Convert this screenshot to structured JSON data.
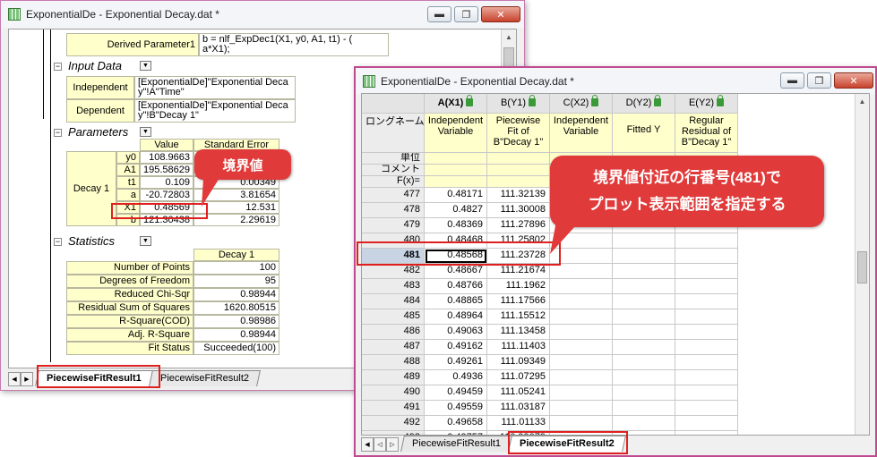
{
  "window1": {
    "title": "ExponentialDe - Exponential Decay.dat *",
    "derived_parameter_label": "Derived Parameter1",
    "derived_parameter_value_line1": "b = nlf_ExpDec1(X1, y0, A1, t1) - (",
    "derived_parameter_value_line2": "a*X1);",
    "input_data": {
      "section": "Input Data",
      "independent_label": "Independent",
      "independent_line1": "[ExponentialDe]\"Exponential Deca",
      "independent_line2": "y\"!A\"Time\"",
      "dependent_label": "Dependent",
      "dependent_line1": "[ExponentialDe]\"Exponential Deca",
      "dependent_line2": "y\"!B\"Decay 1\""
    },
    "parameters": {
      "section": "Parameters",
      "col_value": "Value",
      "col_stderr": "Standard Error",
      "group_label": "Decay 1",
      "rows": [
        {
          "name": "y0",
          "value": "108.9663",
          "stderr": ""
        },
        {
          "name": "A1",
          "value": "195.58629",
          "stderr": ""
        },
        {
          "name": "t1",
          "value": "0.109",
          "stderr": "0.00349"
        },
        {
          "name": "a",
          "value": "-20.72803",
          "stderr": "3.81654"
        },
        {
          "name": "X1",
          "value": "0.48569",
          "stderr": "12.531"
        },
        {
          "name": "b",
          "value": "121.30438",
          "stderr": "2.29619"
        }
      ]
    },
    "statistics": {
      "section": "Statistics",
      "col_header": "Decay 1",
      "rows": [
        {
          "label": "Number of Points",
          "value": "100"
        },
        {
          "label": "Degrees of Freedom",
          "value": "95"
        },
        {
          "label": "Reduced Chi-Sqr",
          "value": "0.98944"
        },
        {
          "label": "Residual Sum of Squares",
          "value": "1620.80515"
        },
        {
          "label": "R-Square(COD)",
          "value": "0.98986"
        },
        {
          "label": "Adj. R-Square",
          "value": "0.98944"
        },
        {
          "label": "Fit Status",
          "value": "Succeeded(100)"
        }
      ]
    },
    "tabs": [
      "PiecewiseFitResult1",
      "PiecewiseFitResult2"
    ],
    "active_tab": "PiecewiseFitResult1",
    "callout": "境界値"
  },
  "window2": {
    "title": "ExponentialDe - Exponential Decay.dat *",
    "columns": [
      {
        "name": "A(X1)",
        "longname": [
          "Independent",
          "Variable"
        ]
      },
      {
        "name": "B(Y1)",
        "longname": [
          "Piecewise",
          "Fit of",
          "B\"Decay 1\""
        ]
      },
      {
        "name": "C(X2)",
        "longname": [
          "Independent",
          "Variable"
        ]
      },
      {
        "name": "D(Y2)",
        "longname": [
          "Fitted Y"
        ]
      },
      {
        "name": "E(Y2)",
        "longname": [
          "Regular",
          "Residual of",
          "B\"Decay 1\""
        ]
      }
    ],
    "meta_rows": [
      "ロングネーム",
      "単位",
      "コメント",
      "F(x)="
    ],
    "rows": [
      {
        "n": "477",
        "a": "0.48171",
        "b": "111.32139"
      },
      {
        "n": "478",
        "a": "0.4827",
        "b": "111.30008"
      },
      {
        "n": "479",
        "a": "0.48369",
        "b": "111.27896"
      },
      {
        "n": "480",
        "a": "0.48468",
        "b": "111.25802"
      },
      {
        "n": "481",
        "a": "0.48568",
        "b": "111.23728"
      },
      {
        "n": "482",
        "a": "0.48667",
        "b": "111.21674"
      },
      {
        "n": "483",
        "a": "0.48766",
        "b": "111.1962"
      },
      {
        "n": "484",
        "a": "0.48865",
        "b": "111.17566"
      },
      {
        "n": "485",
        "a": "0.48964",
        "b": "111.15512"
      },
      {
        "n": "486",
        "a": "0.49063",
        "b": "111.13458"
      },
      {
        "n": "487",
        "a": "0.49162",
        "b": "111.11403"
      },
      {
        "n": "488",
        "a": "0.49261",
        "b": "111.09349"
      },
      {
        "n": "489",
        "a": "0.4936",
        "b": "111.07295"
      },
      {
        "n": "490",
        "a": "0.49459",
        "b": "111.05241"
      },
      {
        "n": "491",
        "a": "0.49559",
        "b": "111.03187"
      },
      {
        "n": "492",
        "a": "0.49658",
        "b": "111.01133"
      },
      {
        "n": "493",
        "a": "0.49757",
        "b": "110.99079"
      }
    ],
    "selected_row": "481",
    "tabs": [
      "PiecewiseFitResult1",
      "PiecewiseFitResult2"
    ],
    "active_tab": "PiecewiseFitResult2",
    "callout_line1": "境界値付近の行番号(481)で",
    "callout_line2": "プロット表示範囲を指定する"
  },
  "colors": {
    "accent_red": "#e03a3a",
    "meta_yellow": "#ffffcc"
  }
}
